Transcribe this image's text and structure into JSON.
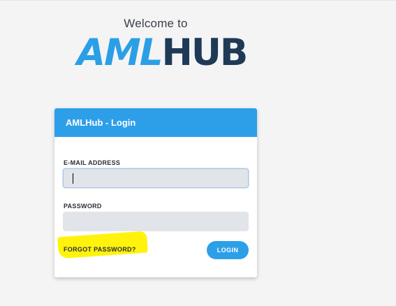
{
  "header": {
    "welcome_text": "Welcome to",
    "logo_part1": "AML",
    "logo_part2": "HUB"
  },
  "login_card": {
    "title": "AMLHub - Login",
    "email_label": "E-MAIL ADDRESS",
    "email_value": "",
    "password_label": "PASSWORD",
    "password_value": "",
    "forgot_password": "FORGOT PASSWORD?",
    "login_button": "LOGIN"
  },
  "colors": {
    "accent_blue": "#2d9fe9",
    "logo_navy": "#1f3a57",
    "highlight_yellow": "#fff200"
  }
}
